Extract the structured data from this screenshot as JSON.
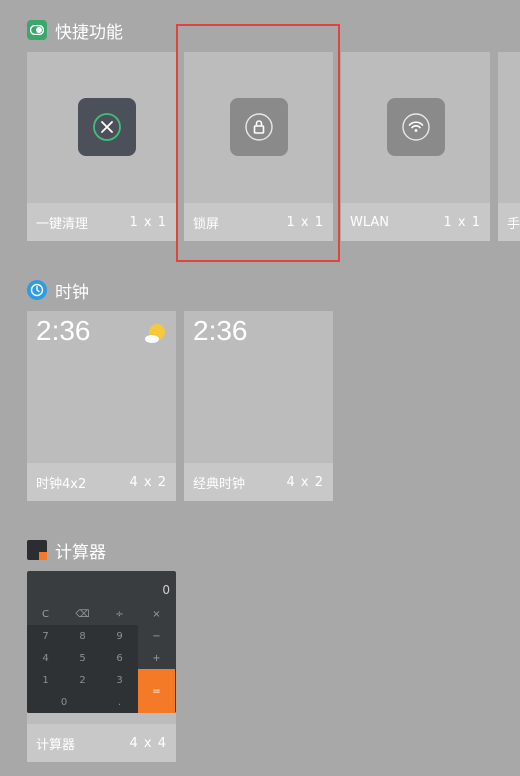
{
  "sections": {
    "quick": {
      "title": "快捷功能"
    },
    "clock": {
      "title": "时钟"
    },
    "calculator": {
      "title": "计算器"
    }
  },
  "quick_tiles": [
    {
      "label": "一键清理",
      "size": "1 x 1",
      "icon": "clean-icon"
    },
    {
      "label": "锁屏",
      "size": "1 x 1",
      "icon": "lock-icon"
    },
    {
      "label": "WLAN",
      "size": "1 x 1",
      "icon": "wifi-icon"
    },
    {
      "label": "手",
      "size": "",
      "icon": ""
    }
  ],
  "clock_tiles": [
    {
      "label": "时钟4x2",
      "size": "4 x 2",
      "time": "2:36",
      "icon": "weather-sun-icon"
    },
    {
      "label": "经典时钟",
      "size": "4 x 2",
      "time": "2:36"
    }
  ],
  "calculator_tile": {
    "label": "计算器",
    "size": "4 x 4",
    "display": "0",
    "keys": {
      "row1": [
        "C",
        "⌫",
        "÷",
        "×"
      ],
      "row2": [
        "7",
        "8",
        "9",
        "−"
      ],
      "row3": [
        "4",
        "5",
        "6",
        "+"
      ],
      "row4": [
        "1",
        "2",
        "3"
      ],
      "row5": [
        "0",
        ".",
        "="
      ]
    }
  },
  "colors": {
    "background": "#a8a8a8",
    "highlight": "#e0443c",
    "accent": "#f47a28",
    "quick_icon": "#3aa86b",
    "clock_icon": "#2f9be0"
  }
}
